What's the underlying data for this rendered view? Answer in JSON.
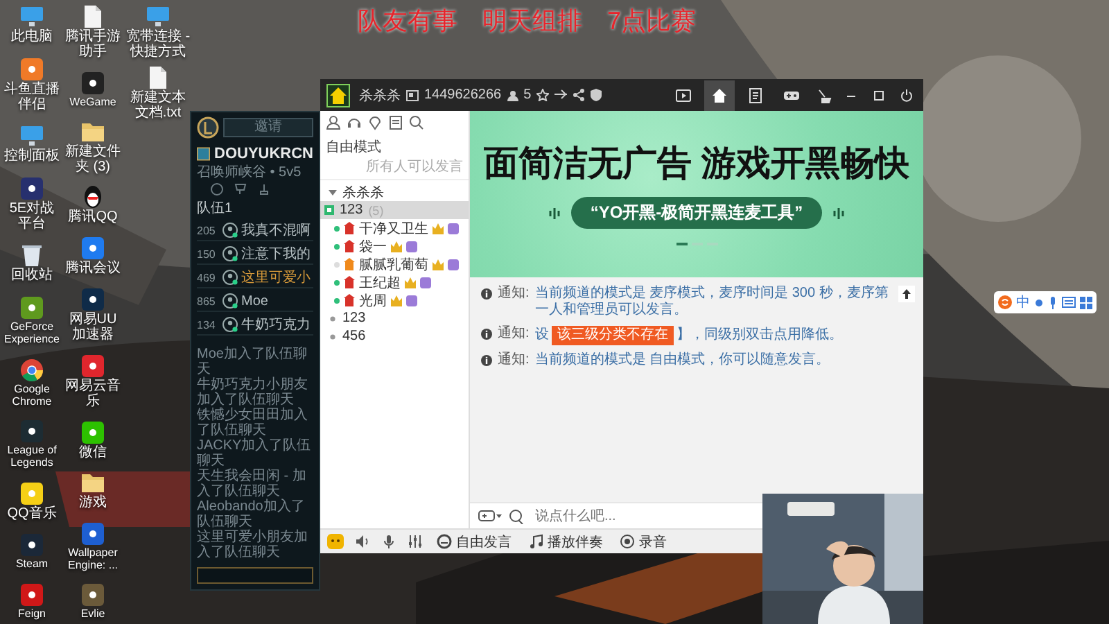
{
  "overlay_caption": "队友有事　明天组排　7点比赛",
  "desktop_columns": [
    [
      {
        "label": "此电脑",
        "kind": "monitor"
      },
      {
        "label": "斗鱼直播伴侣",
        "kind": "app",
        "color": "#f07a28"
      },
      {
        "label": "控制面板",
        "kind": "monitor"
      },
      {
        "label": "5E对战平台",
        "kind": "app",
        "color": "#27306e"
      },
      {
        "label": "回收站",
        "kind": "bin"
      },
      {
        "label": "GeForce Experience",
        "kind": "app",
        "color": "#5f9a1e"
      },
      {
        "label": "Google Chrome",
        "kind": "chrome"
      },
      {
        "label": "League of Legends",
        "kind": "app",
        "color": "#1d2c33"
      },
      {
        "label": "QQ音乐",
        "kind": "app",
        "color": "#f5cf16"
      },
      {
        "label": "Steam",
        "kind": "app",
        "color": "#1b2838"
      },
      {
        "label": "Feign",
        "kind": "app",
        "color": "#d01818"
      }
    ],
    [
      {
        "label": "腾讯手游助手",
        "kind": "doc"
      },
      {
        "label": "WeGame",
        "kind": "app",
        "color": "#222222"
      },
      {
        "label": "新建文件夹 (3)",
        "kind": "folder"
      },
      {
        "label": "腾讯QQ",
        "kind": "penguin"
      },
      {
        "label": "腾讯会议",
        "kind": "app",
        "color": "#1f7bf0"
      },
      {
        "label": "网易UU加速器",
        "kind": "app",
        "color": "#0f2b48"
      },
      {
        "label": "网易云音乐",
        "kind": "app",
        "color": "#e0262d"
      },
      {
        "label": "微信",
        "kind": "app",
        "color": "#2dc100"
      },
      {
        "label": "游戏",
        "kind": "folder"
      },
      {
        "label": "Wallpaper Engine: ...",
        "kind": "app",
        "color": "#1e5fd1"
      },
      {
        "label": "Evlie",
        "kind": "app",
        "color": "#6b5a3a"
      }
    ],
    [
      {
        "label": "宽带连接 - 快捷方式",
        "kind": "monitor"
      },
      {
        "label": "新建文本文档.txt",
        "kind": "doc"
      }
    ]
  ],
  "lol": {
    "invite": "邀请",
    "title": "DOUYUKRCN",
    "subtitle": "召唤师峡谷 • 5v5",
    "team": "队伍1",
    "players": [
      {
        "score": "205",
        "name": "我真不混啊",
        "highlighted": false
      },
      {
        "score": "150",
        "name": "注意下我的",
        "highlighted": false
      },
      {
        "score": "469",
        "name": "这里可爱小",
        "highlighted": true
      },
      {
        "score": "865",
        "name": "Moe",
        "highlighted": false
      },
      {
        "score": "134",
        "name": "牛奶巧克力",
        "highlighted": false
      }
    ],
    "chat": [
      "Moe加入了队伍聊天",
      "牛奶巧克力小朋友加入了队伍聊天",
      "铁憾少女田田加入了队伍聊天",
      "JACKY加入了队伍聊天",
      "天生我会田闲 - 加入了队伍聊天",
      "Aleobando加入了队伍聊天",
      "这里可爱小朋友加入了队伍聊天"
    ]
  },
  "yy": {
    "channel_name": "杀杀杀",
    "channel_id": "1449626266",
    "online_count": "5",
    "nav": [
      {
        "kind": "video",
        "selected": false
      },
      {
        "kind": "home",
        "selected": true
      },
      {
        "kind": "note",
        "selected": false
      },
      {
        "kind": "gamepad",
        "selected": false
      }
    ],
    "mode": "自由模式",
    "mode_note": "所有人可以发言",
    "tree": [
      {
        "name": "杀杀杀",
        "expanded": true,
        "selected": false,
        "children": [
          {
            "name": "123",
            "count": "(5)",
            "selected": true,
            "children": [
              {
                "name": "干净又卫生",
                "online": true,
                "color": "#d8322a"
              },
              {
                "name": "袋一",
                "online": true,
                "color": "#d8322a"
              },
              {
                "name": "腻腻乳葡萄",
                "online": false,
                "color": "#f08a1c"
              },
              {
                "name": "王纪超",
                "online": true,
                "color": "#d8322a"
              },
              {
                "name": "光周",
                "online": true,
                "color": "#d8322a"
              }
            ]
          }
        ]
      },
      {
        "name": "123",
        "expanded": false,
        "selected": false
      },
      {
        "name": "456",
        "expanded": false,
        "selected": false
      }
    ],
    "banner": {
      "headline": "面简洁无广告  游戏开黑畅快",
      "tagline": "“YO开黑-极简开黑连麦工具”"
    },
    "notices": [
      {
        "label": "通知:",
        "text": "当前频道的模式是 麦序模式，麦序时间是 300 秒，麦序第一人和管理员可以发言。"
      },
      {
        "label": "通知:",
        "text": "设",
        "tooltip": "该三级分类不存在",
        "text_after": "】，同级别双击点用降低。"
      },
      {
        "label": "通知:",
        "text": "当前频道的模式是 自由模式，你可以随意发言。"
      }
    ],
    "input_placeholder": "说点什么吧...",
    "bottom_buttons": [
      {
        "label": "自由发言",
        "kind": "face"
      },
      {
        "label": "播放伴奏",
        "kind": "music"
      },
      {
        "label": "录音",
        "kind": "record"
      }
    ]
  },
  "ime": {
    "mode": "中"
  }
}
